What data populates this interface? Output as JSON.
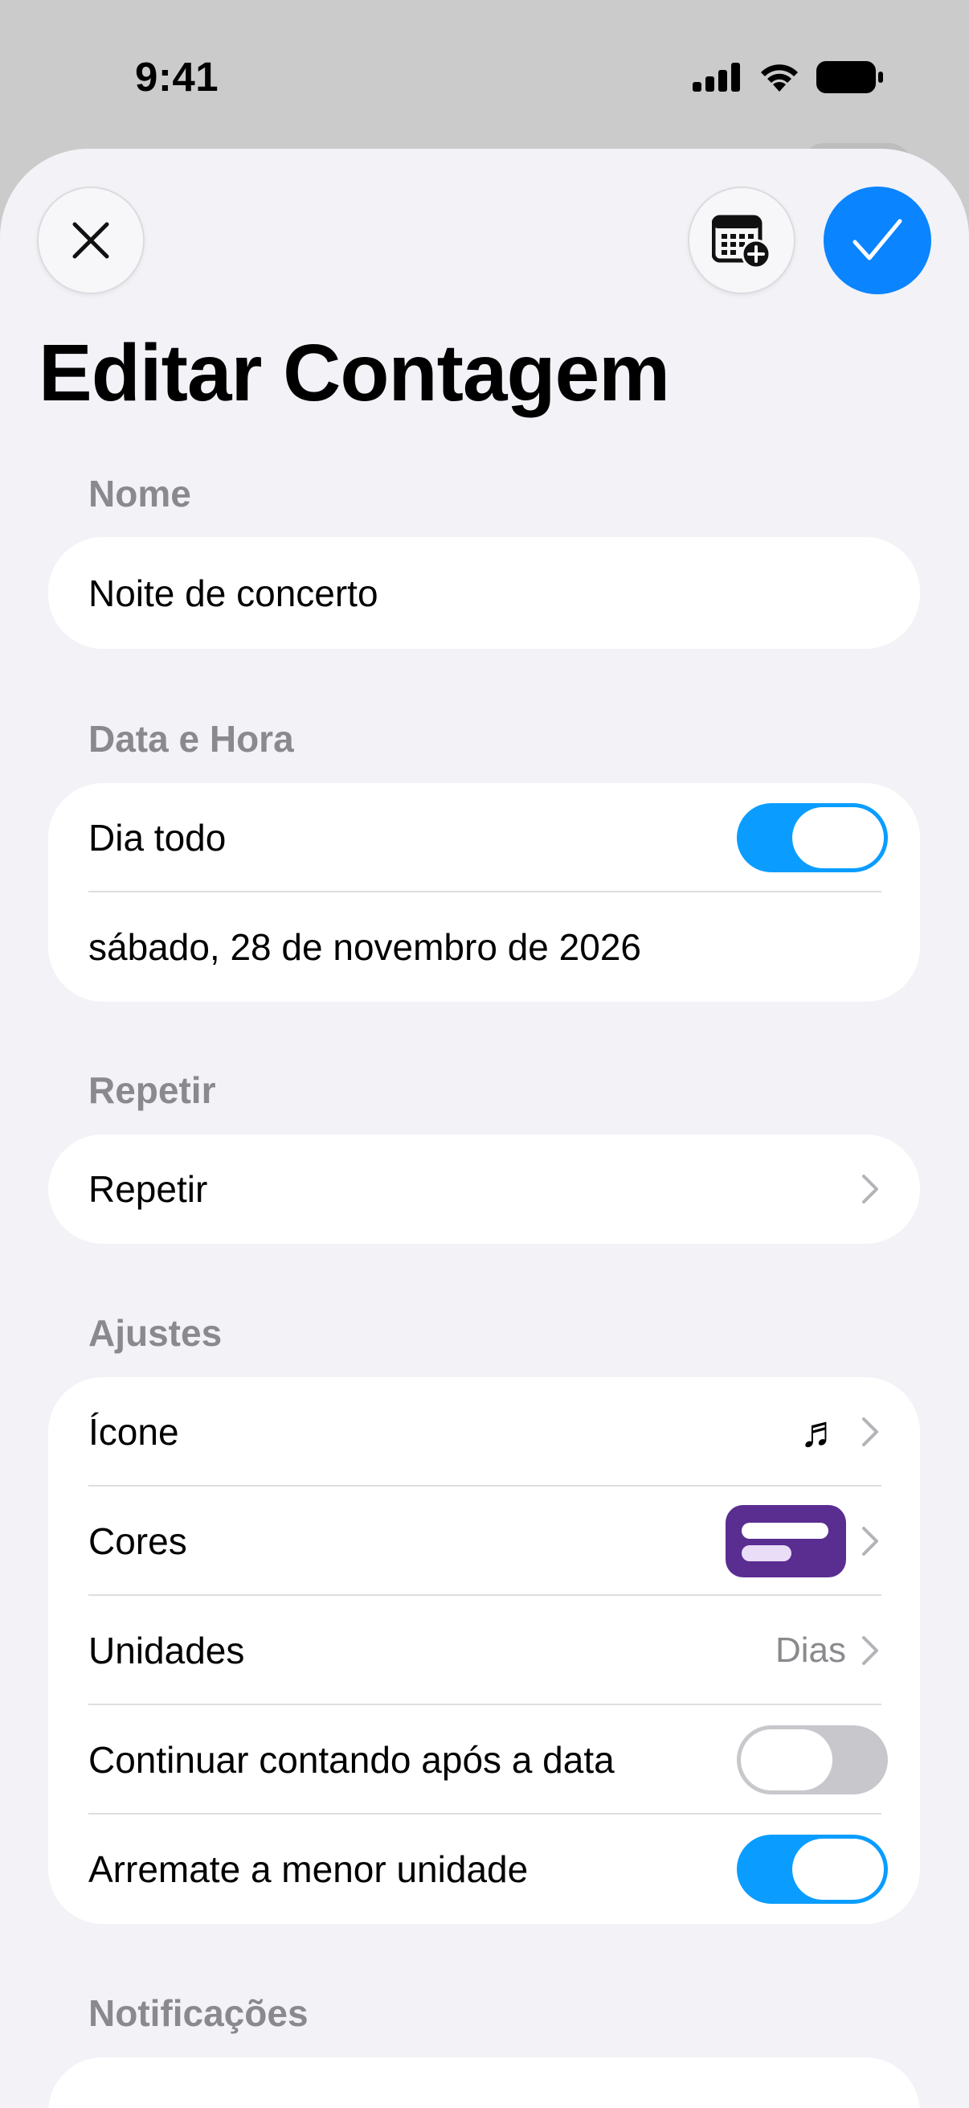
{
  "status_bar": {
    "time": "9:41"
  },
  "header": {
    "title": "Editar Contagem"
  },
  "sections": {
    "name": {
      "header": "Nome",
      "value": "Noite de concerto"
    },
    "datetime": {
      "header": "Data e Hora",
      "all_day_label": "Dia todo",
      "all_day_on": true,
      "date": "sábado, 28 de novembro de 2026"
    },
    "repeat": {
      "header": "Repetir",
      "label": "Repetir"
    },
    "settings": {
      "header": "Ajustes",
      "icon_label": "Ícone",
      "icon_value": "music-note-icon",
      "colors_label": "Cores",
      "color_value": "#5a2d91",
      "units_label": "Unidades",
      "units_value": "Dias",
      "continue_label": "Continuar contando após a data",
      "continue_on": false,
      "round_label": "Arremate a menor unidade",
      "round_on": true
    },
    "notifications": {
      "header": "Notificações"
    }
  },
  "colors": {
    "accent": "#0a84ff",
    "toggle_on": "#0a9dff",
    "toggle_off": "#c8c8cc",
    "background": "#f2f2f7"
  }
}
